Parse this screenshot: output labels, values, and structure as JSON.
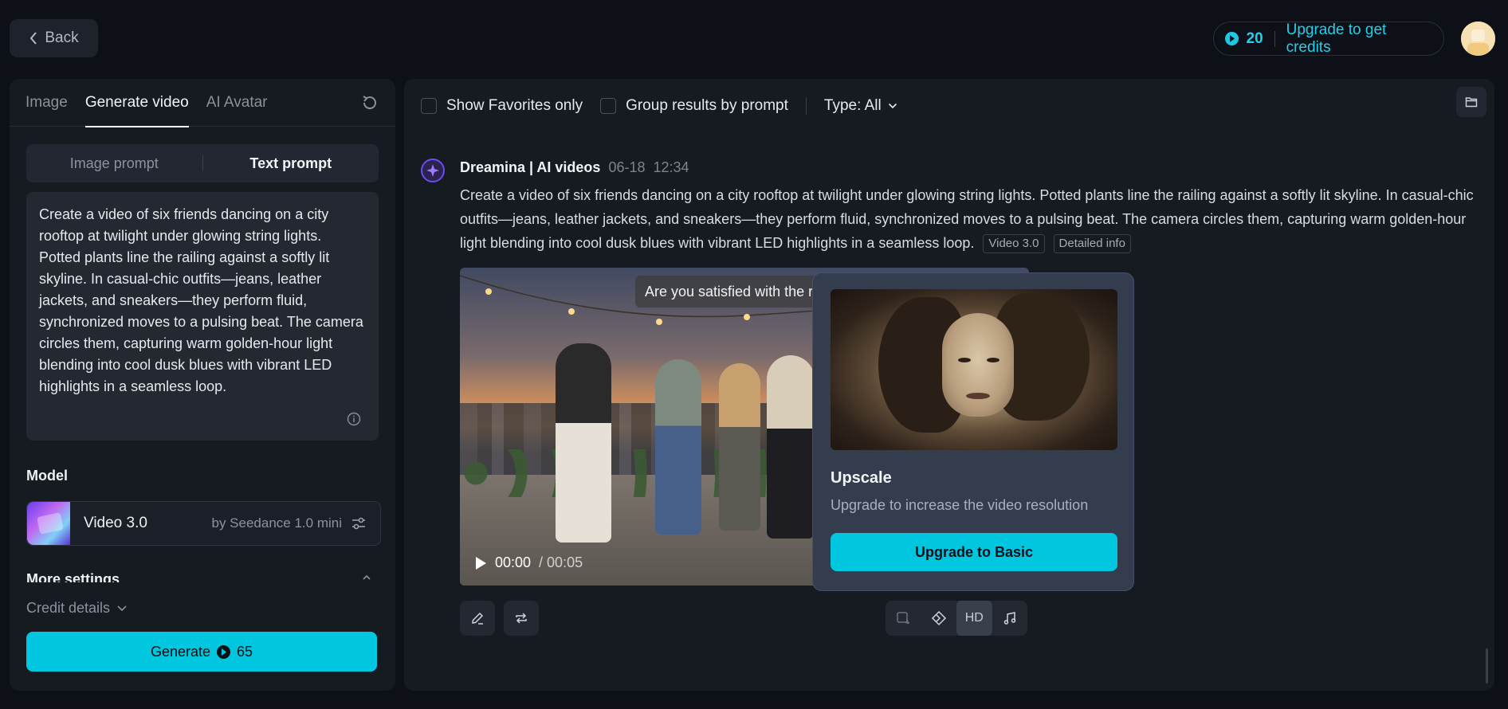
{
  "topbar": {
    "back_label": "Back",
    "credits_count": "20",
    "upgrade_label": "Upgrade to get credits"
  },
  "left": {
    "tabs": [
      {
        "label": "Image"
      },
      {
        "label": "Generate video"
      },
      {
        "label": "AI Avatar"
      }
    ],
    "prompt_modes": [
      {
        "label": "Image prompt"
      },
      {
        "label": "Text prompt"
      }
    ],
    "prompt_text": "Create a video of six friends dancing on a city rooftop at twilight under glowing string lights. Potted plants line the railing against a softly lit skyline. In casual-chic outfits—jeans, leather jackets, and sneakers—they perform fluid, synchronized moves to a pulsing beat. The camera circles them, capturing warm golden-hour light blending into cool dusk blues with vibrant LED highlights in a seamless loop.",
    "model_label": "Model",
    "model_name": "Video 3.0",
    "model_by": "by Seedance 1.0 mini",
    "more_settings": "More settings",
    "credit_details": "Credit details",
    "generate_label": "Generate",
    "generate_cost": "65"
  },
  "right": {
    "filters": {
      "favorites": "Show Favorites only",
      "group": "Group results by prompt",
      "type": "Type: All"
    },
    "result": {
      "source": "Dreamina | AI videos",
      "date": "06-18",
      "time": "12:34",
      "prompt": "Create a video of six friends dancing on a city rooftop at twilight under glowing string lights. Potted plants line the railing against a softly lit skyline. In casual-chic outfits—jeans, leather jackets, and sneakers—they perform fluid, synchronized moves to a pulsing beat. The camera circles them, capturing warm golden-hour light blending into cool dusk blues with vibrant LED highlights in a seamless loop.",
      "chip_model": "Video 3.0",
      "chip_info": "Detailed info",
      "satisfied_prompt": "Are you satisfied with the result?",
      "time_current": "00:00",
      "time_total": "/ 00:05",
      "hd_label": "HD"
    },
    "upscale": {
      "title": "Upscale",
      "desc": "Upgrade to increase the video resolution",
      "button": "Upgrade to Basic"
    }
  },
  "colors": {
    "accent": "#00c6e0",
    "background": "#0d1017",
    "panel": "#161a21"
  }
}
